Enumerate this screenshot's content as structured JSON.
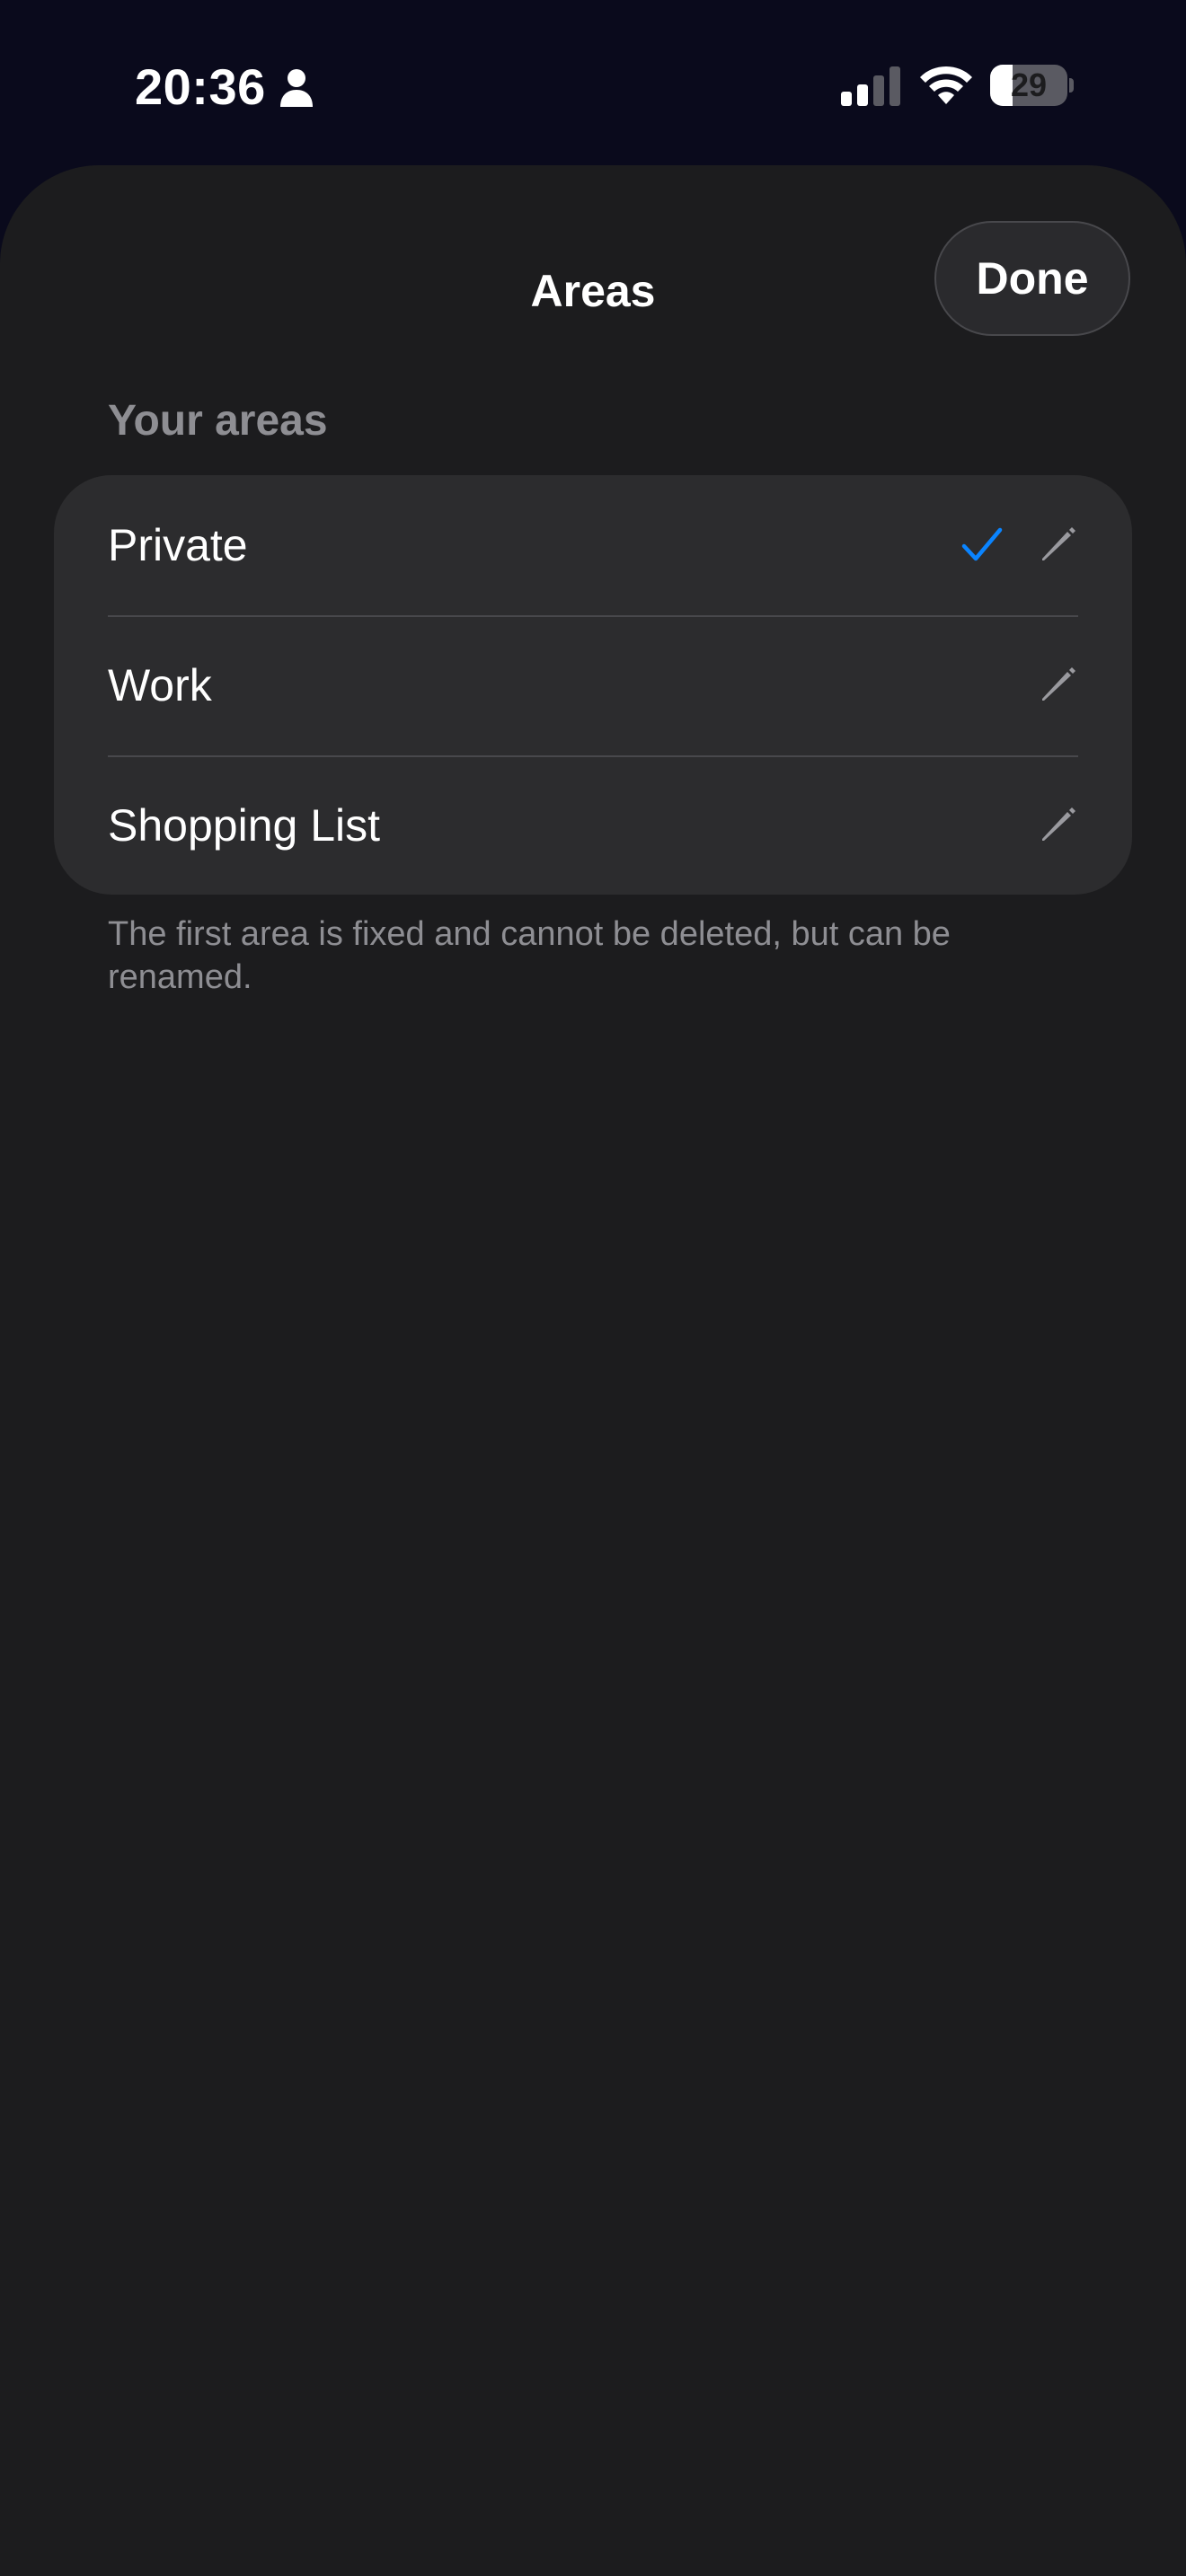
{
  "status_bar": {
    "time": "20:36",
    "battery_level": "29",
    "battery_fraction": 0.29
  },
  "sheet": {
    "title": "Areas",
    "done_label": "Done",
    "section_header": "Your areas",
    "footer_note": "The first area is fixed and cannot be deleted, but can be renamed."
  },
  "areas": [
    {
      "label": "Private",
      "selected": true
    },
    {
      "label": "Work",
      "selected": false
    },
    {
      "label": "Shopping List",
      "selected": false
    }
  ],
  "colors": {
    "accent": "#0a84ff",
    "sheet_background": "#1c1c1e",
    "card_background": "#2c2c2e",
    "secondary_text": "#8e8e93"
  },
  "icons": {
    "status_person": "person-icon",
    "status_signal": "cellular-signal-icon",
    "status_wifi": "wifi-icon",
    "status_battery": "battery-icon",
    "selected": "checkmark-icon",
    "edit": "pencil-icon"
  }
}
